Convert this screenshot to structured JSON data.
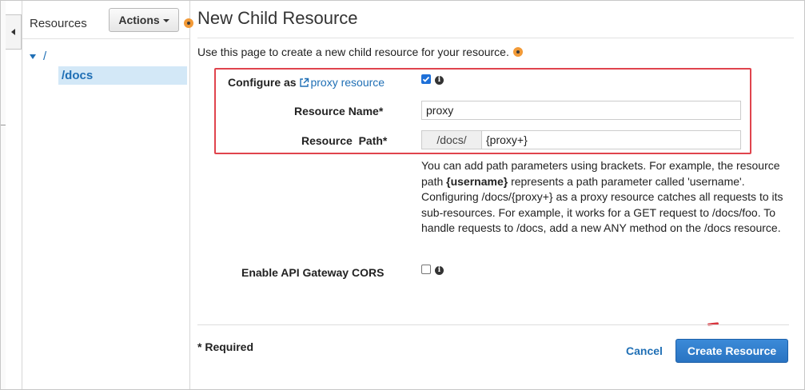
{
  "sidebar": {
    "title": "Resources",
    "actions_label": "Actions",
    "tree": {
      "root": "/",
      "child": "/docs"
    }
  },
  "main": {
    "title": "New Child Resource",
    "intro": "Use this page to create a new child resource for your resource.",
    "form": {
      "configure_label": "Configure as",
      "proxy_link": "proxy resource",
      "proxy_checked": true,
      "resource_name_label": "Resource Name*",
      "resource_name_value": "proxy",
      "resource_path_label": "Resource  Path*",
      "resource_path_prefix": "/docs/",
      "resource_path_value": "{proxy+}",
      "help": {
        "part1": "You can add path parameters using brackets. For example, the resource path ",
        "bold": "{username}",
        "part2": " represents a path parameter called 'username'. Configuring /docs/{proxy+} as a proxy resource catches all requests to its sub-resources. For example, it works for a GET request to /docs/foo. To handle requests to /docs, add a new ANY method on the /docs resource."
      },
      "cors_label": "Enable API Gateway CORS",
      "cors_checked": false
    },
    "footer": {
      "required_note": "* Required",
      "cancel_label": "Cancel",
      "create_label": "Create Resource"
    }
  },
  "colors": {
    "accent": "#1f6fb5",
    "primary_button": "#2a74c2",
    "highlight_border": "#e0444d",
    "tree_selection": "#d3e8f7",
    "annotation_dot": "#f29a37"
  },
  "icons": [
    "collapse-left-icon",
    "caret-down-icon",
    "tree-expand-icon",
    "external-link-icon",
    "info-icon",
    "checkmark-icon"
  ]
}
